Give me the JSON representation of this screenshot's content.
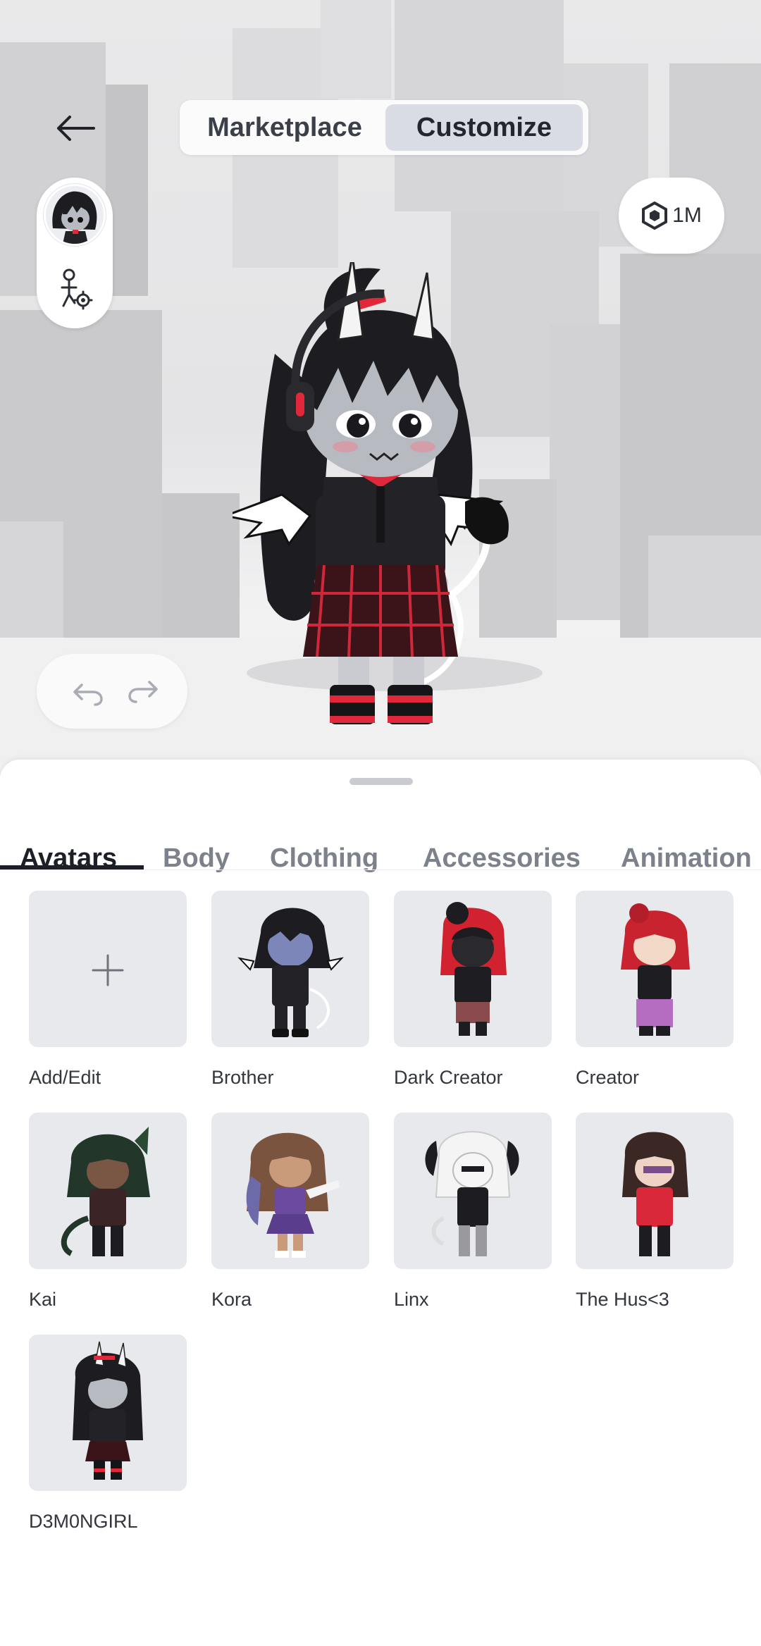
{
  "header": {
    "back_icon": "arrow-left-icon",
    "segments": {
      "marketplace": "Marketplace",
      "customize": "Customize",
      "active": "customize"
    },
    "robux": {
      "icon": "robux-hexagon-icon",
      "amount": "1M"
    }
  },
  "side_panel": {
    "avatar_icon": "avatar-headshot",
    "settings_icon": "avatar-settings-icon"
  },
  "history": {
    "undo_icon": "undo-icon",
    "redo_icon": "redo-icon"
  },
  "colors": {
    "accent_red": "#e0283a",
    "hair_black": "#1d1d21",
    "skin_gray": "#b8bac2",
    "selected_segment": "#d9dce3"
  },
  "tabs": [
    {
      "label": "Avatars",
      "active": true
    },
    {
      "label": "Body"
    },
    {
      "label": "Clothing"
    },
    {
      "label": "Accessories"
    },
    {
      "label": "Animation"
    }
  ],
  "avatars": [
    {
      "label": "Add/Edit",
      "icon": "plus-icon"
    },
    {
      "label": "Brother"
    },
    {
      "label": "Dark Creator"
    },
    {
      "label": "Creator"
    },
    {
      "label": "Kai"
    },
    {
      "label": "Kora"
    },
    {
      "label": "Linx"
    },
    {
      "label": "The Hus<3"
    },
    {
      "label": "D3M0NGIRL"
    }
  ]
}
